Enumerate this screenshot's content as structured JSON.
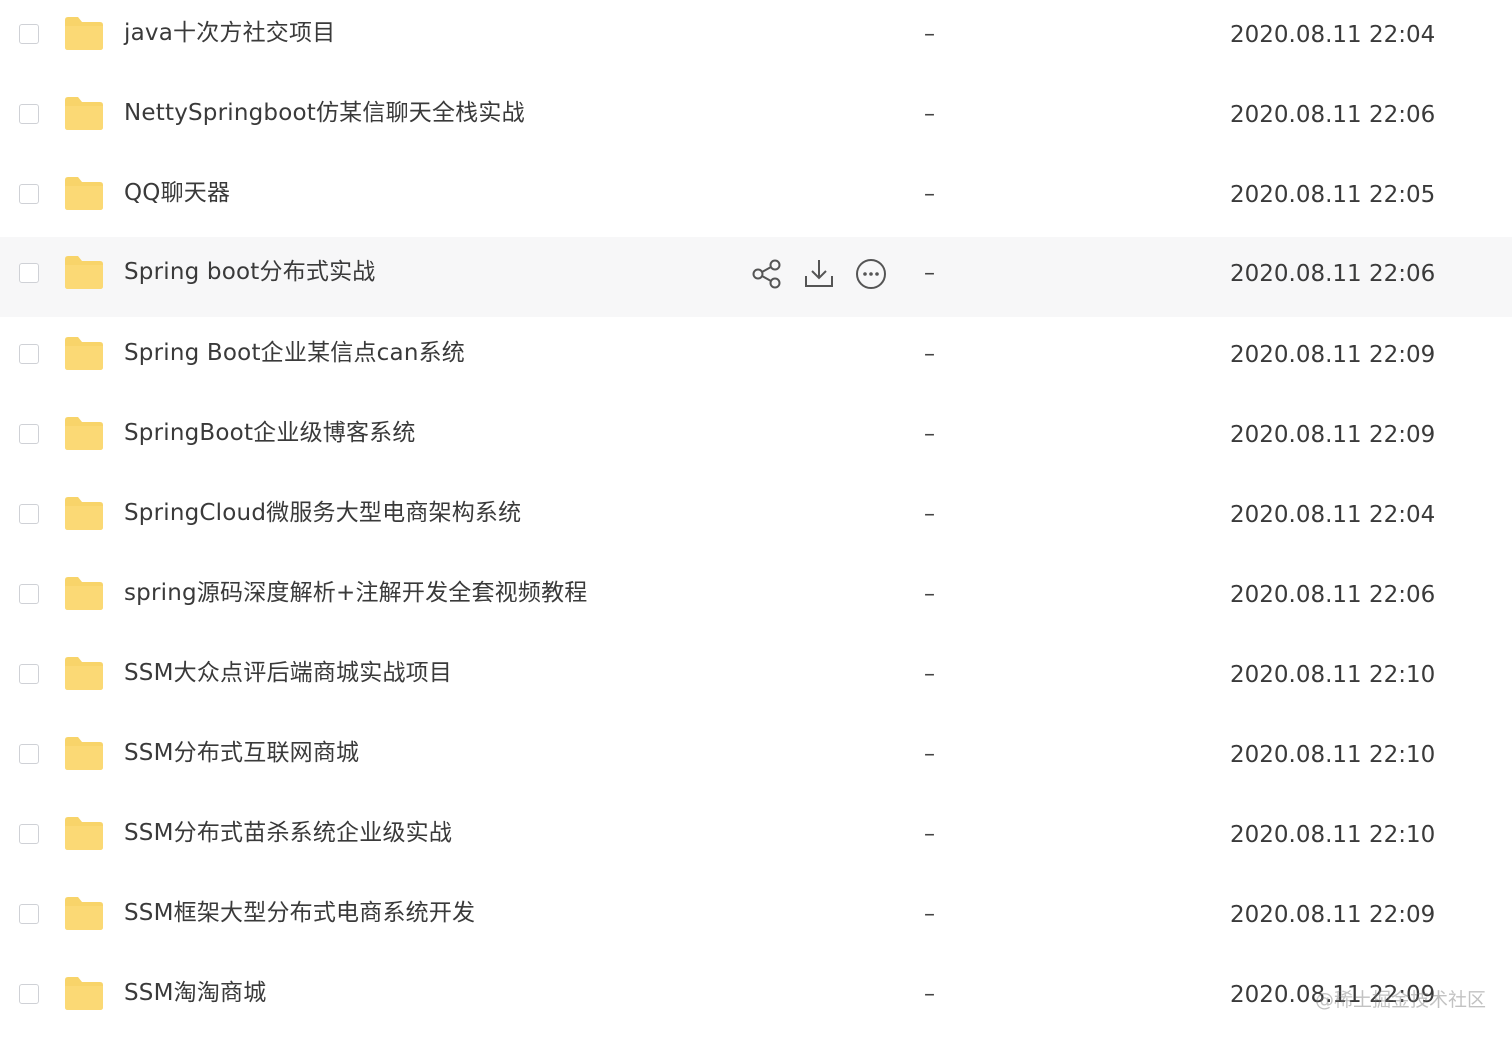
{
  "files": [
    {
      "name": "java十次方社交项目",
      "size": "–",
      "date": "2020.08.11 22:04"
    },
    {
      "name": "NettySpringboot仿某信聊天全栈实战",
      "size": "–",
      "date": "2020.08.11 22:06"
    },
    {
      "name": "QQ聊天器",
      "size": "–",
      "date": "2020.08.11 22:05"
    },
    {
      "name": "Spring boot分布式实战",
      "size": "–",
      "date": "2020.08.11 22:06"
    },
    {
      "name": "Spring Boot企业某信点can系统",
      "size": "–",
      "date": "2020.08.11 22:09"
    },
    {
      "name": "SpringBoot企业级博客系统",
      "size": "–",
      "date": "2020.08.11 22:09"
    },
    {
      "name": "SpringCloud微服务大型电商架构系统",
      "size": "–",
      "date": "2020.08.11 22:04"
    },
    {
      "name": "spring源码深度解析+注解开发全套视频教程",
      "size": "–",
      "date": "2020.08.11 22:06"
    },
    {
      "name": "SSM大众点评后端商城实战项目",
      "size": "–",
      "date": "2020.08.11 22:10"
    },
    {
      "name": "SSM分布式互联网商城",
      "size": "–",
      "date": "2020.08.11 22:10"
    },
    {
      "name": "SSM分布式苗杀系统企业级实战",
      "size": "–",
      "date": "2020.08.11 22:10"
    },
    {
      "name": "SSM框架大型分布式电商系统开发",
      "size": "–",
      "date": "2020.08.11 22:09"
    },
    {
      "name": "SSM淘淘商城",
      "size": "–",
      "date": "2020.08.11 22:09"
    }
  ],
  "hover_actions": {
    "share_icon": "share-icon",
    "download_icon": "download-icon",
    "more_icon": "more-icon"
  },
  "watermark": "@稀土掘金技术社区",
  "colors": {
    "folder": "#f8d46a",
    "hover_row": "#f7f7f8",
    "checkbox_border": "#cfd1d6"
  }
}
